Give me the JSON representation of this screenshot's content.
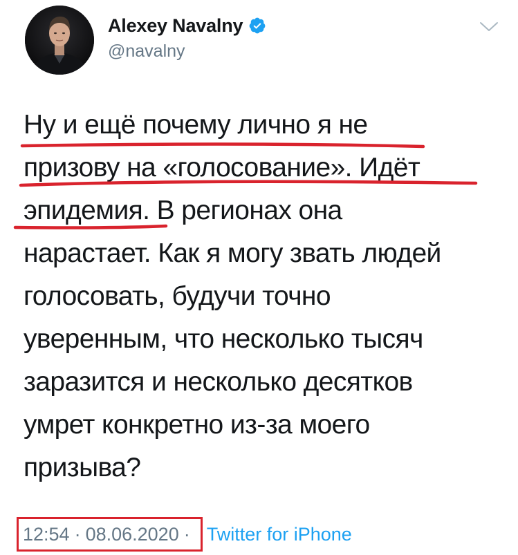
{
  "author": {
    "display_name": "Alexey Navalny",
    "handle": "@navalny",
    "verified": true
  },
  "tweet": {
    "lines": [
      "Ну и ещё почему лично я не",
      "призову на «голосование». Идёт",
      "эпидемия. В регионах она",
      "нарастает. Как я могу звать людей",
      "голосовать, будучи точно",
      "уверенным, что несколько тысяч",
      "заразится и несколько десятков",
      "умрет конкретно из-за моего",
      "призыва?"
    ],
    "time": "12:54",
    "separator": "·",
    "date": "08.06.2020",
    "source": "Twitter for iPhone"
  },
  "icons": {
    "verified": "verified-badge-icon",
    "menu": "chevron-down-icon"
  },
  "colors": {
    "text": "#14171a",
    "secondary": "#657786",
    "link": "#1da1f2",
    "verified": "#1da1f2",
    "annotation_red": "#d9232d"
  }
}
